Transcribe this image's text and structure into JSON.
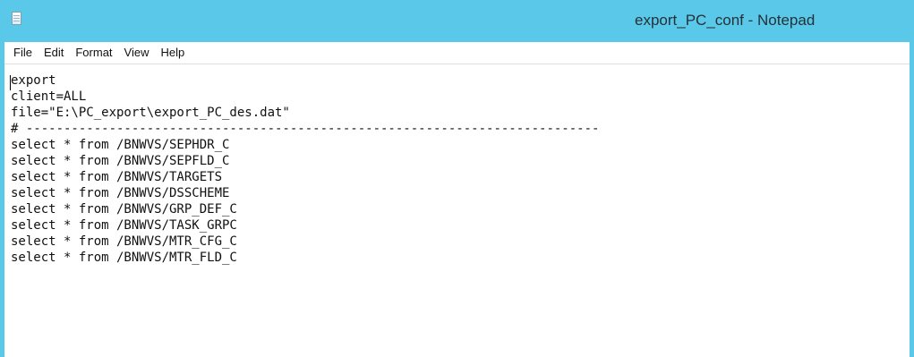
{
  "window": {
    "title": "export_PC_conf - Notepad"
  },
  "menu": {
    "items": [
      "File",
      "Edit",
      "Format",
      "View",
      "Help"
    ]
  },
  "editor": {
    "lines": [
      "export",
      "client=ALL",
      "file=\"E:\\PC_export\\export_PC_des.dat\"",
      "# ----------------------------------------------------------------------------",
      "select * from /BNWVS/SEPHDR_C",
      "select * from /BNWVS/SEPFLD_C",
      "select * from /BNWVS/TARGETS",
      "select * from /BNWVS/DSSCHEME",
      "select * from /BNWVS/GRP_DEF_C",
      "select * from /BNWVS/TASK_GRPC",
      "select * from /BNWVS/MTR_CFG_C",
      "select * from /BNWVS/MTR_FLD_C"
    ]
  },
  "icons": {
    "app": "notepad-document-icon"
  }
}
